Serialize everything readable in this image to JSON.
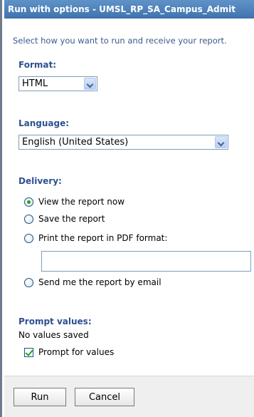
{
  "window": {
    "title": "Run with options - UMSL_RP_SA_Campus_Admit"
  },
  "subtitle": "Select how you want to run and receive your report.",
  "format": {
    "label": "Format:",
    "selected": "HTML"
  },
  "language": {
    "label": "Language:",
    "selected": "English (United States)"
  },
  "delivery": {
    "label": "Delivery:",
    "options": [
      {
        "label": "View the report now",
        "checked": true
      },
      {
        "label": "Save the report",
        "checked": false
      },
      {
        "label": "Print the report in PDF format:",
        "checked": false
      },
      {
        "label": "Send me the report by email",
        "checked": false
      }
    ],
    "printer_field": {
      "value": ""
    }
  },
  "prompt": {
    "label": "Prompt values:",
    "status": "No values saved",
    "checkbox_label": "Prompt for values",
    "checked": true
  },
  "buttons": {
    "run": "Run",
    "cancel": "Cancel"
  },
  "colors": {
    "title_bar": "#3f73ad",
    "section_label": "#2e5090",
    "radio_selected": "#21a121"
  }
}
